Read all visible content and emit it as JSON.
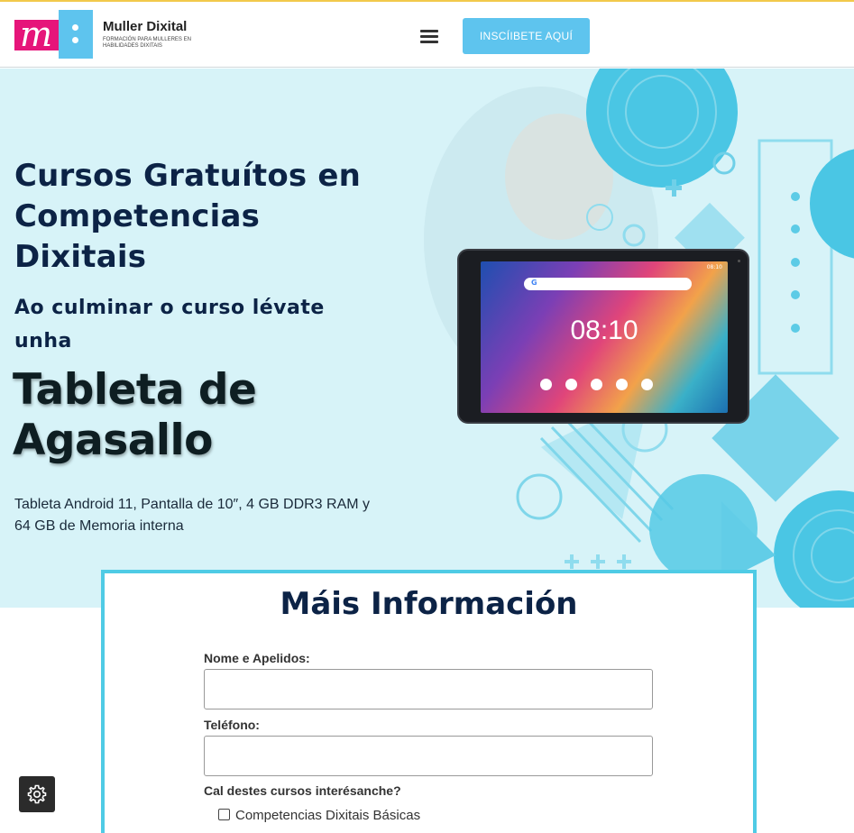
{
  "header": {
    "logo_title": "Muller Dixital",
    "logo_subtitle": "FORMACIÓN PARA MULLERES EN HABILIDADES DIXITAIS",
    "cta_label": "INSCÍIBETE AQUÍ",
    "menu_icon": "hamburger-menu-icon"
  },
  "hero": {
    "title": "Cursos Gratuítos en Competencias Dixitais",
    "subtitle": "Ao culminar o curso lévate unha",
    "prize": "Tableta de Agasallo",
    "description": "Tableta Android 11, Pantalla de 10″, 4 GB DDR3 RAM y 64 GB de Memoria interna",
    "tablet_clock": "08:10"
  },
  "form": {
    "title": "Máis Información",
    "name_label": "Nome e Apelidos:",
    "name_value": "",
    "phone_label": "Teléfono:",
    "phone_value": "",
    "courses_label": "Cal destes cursos interésanche?",
    "course_options": [
      "Competencias Dixitais Básicas"
    ]
  },
  "floating": {
    "settings_icon": "gear-icon"
  },
  "colors": {
    "accent_blue": "#5ec4ee",
    "brand_pink": "#e6157a",
    "navy": "#0c2346",
    "hero_bg": "#d7f3f8",
    "form_border": "#4fcbe5"
  }
}
